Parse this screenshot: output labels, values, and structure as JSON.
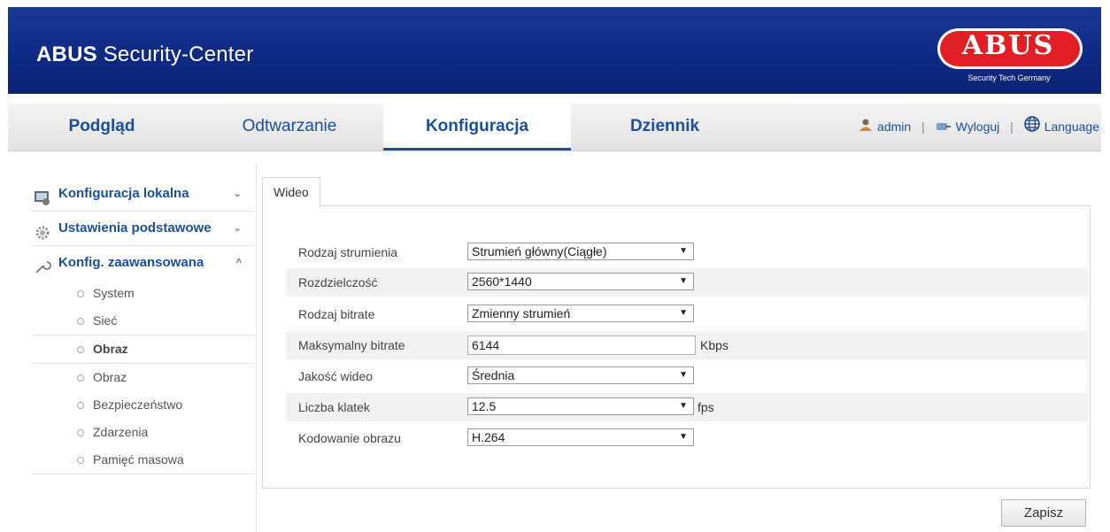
{
  "header": {
    "app_title_bold": "ABUS",
    "app_title_rest": "Security-Center",
    "logo_text": "ABUS",
    "logo_sub": "Security Tech Germany",
    "colors": {
      "header_bg": "#0f2a84",
      "logo_red": "#e21e26",
      "accent": "#1a4f9c"
    }
  },
  "nav": {
    "tabs": [
      {
        "label": "Podgląd"
      },
      {
        "label": "Odtwarzanie"
      },
      {
        "label": "Konfiguracja",
        "active": true
      },
      {
        "label": "Dziennik"
      }
    ],
    "user": "admin",
    "logout": "Wyloguj",
    "language": "Language",
    "icons": {
      "user": "user-icon",
      "logout": "logout-icon",
      "language": "globe-icon"
    }
  },
  "sidebar": {
    "sections": [
      {
        "label": "Konfiguracja lokalna",
        "icon": "local-config-icon",
        "chevron": "⌄"
      },
      {
        "label": "Ustawienia podstawowe",
        "icon": "gear-icon",
        "chevron": "⌄"
      },
      {
        "label": "Konfig. zaawansowana",
        "icon": "wrench-icon",
        "chevron": "^"
      }
    ],
    "items": [
      {
        "label": "System"
      },
      {
        "label": "Sieć"
      },
      {
        "label": "Obraz",
        "active": true
      },
      {
        "label": "Obraz"
      },
      {
        "label": "Bezpieczeństwo"
      },
      {
        "label": "Zdarzenia"
      },
      {
        "label": "Pamięć masowa"
      }
    ]
  },
  "content": {
    "tab_label": "Wideo",
    "fields": [
      {
        "label": "Rodzaj strumienia",
        "value": "Strumień główny(Ciągłe)",
        "type": "select"
      },
      {
        "label": "Rozdzielczość",
        "value": "2560*1440",
        "type": "select"
      },
      {
        "label": "Rodzaj bitrate",
        "value": "Zmienny strumień",
        "type": "select"
      },
      {
        "label": "Maksymalny bitrate",
        "value": "6144",
        "type": "input",
        "unit": "Kbps"
      },
      {
        "label": "Jakość wideo",
        "value": "Średnia",
        "type": "select"
      },
      {
        "label": "Liczba klatek",
        "value": "12.5",
        "type": "select",
        "unit": "fps"
      },
      {
        "label": "Kodowanie obrazu",
        "value": "H.264",
        "type": "select"
      }
    ],
    "dropdown_arrow": "▼",
    "save_label": "Zapisz"
  }
}
